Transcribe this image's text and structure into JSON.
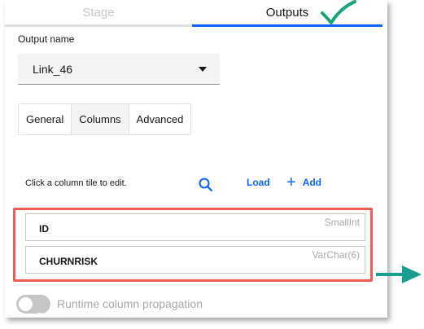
{
  "tabs": {
    "stage": "Stage",
    "outputs": "Outputs"
  },
  "output_name_label": "Output name",
  "output_name_value": "Link_46",
  "subtabs": {
    "general": "General",
    "columns": "Columns",
    "advanced": "Advanced",
    "active": "Columns"
  },
  "columns_toolbar": {
    "hint": "Click a column tile to edit.",
    "load": "Load",
    "add": "Add"
  },
  "columns": [
    {
      "name": "ID",
      "type": "SmallInt"
    },
    {
      "name": "CHURNRISK",
      "type": "VarChar(6)"
    }
  ],
  "runtime_propagation": {
    "label": "Runtime column propagation",
    "enabled": false
  },
  "icons": [
    "checkmark-icon",
    "search-icon",
    "add-icon",
    "chevron-down-icon",
    "arrow-right-icon"
  ],
  "colors": {
    "accent": "#0f62fe",
    "highlight": "#ef5c52",
    "check": "#1aa37f",
    "arrow": "#1a9e8f"
  }
}
